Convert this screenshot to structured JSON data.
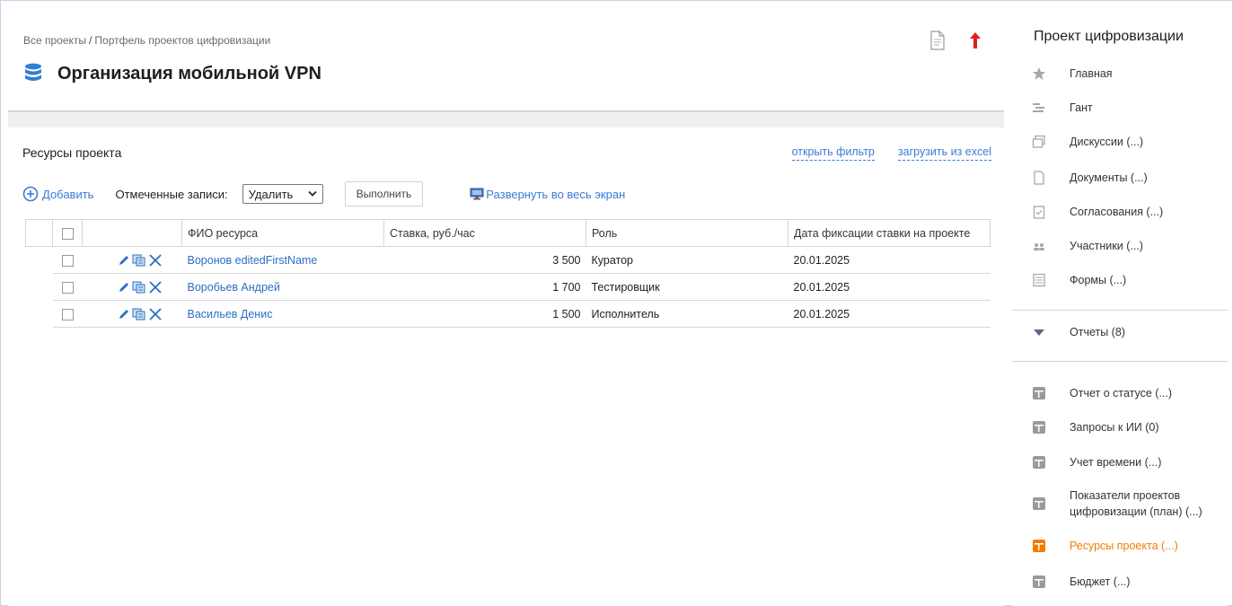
{
  "header": {
    "breadcrumb": {
      "root": "Все проекты",
      "separator": "/",
      "current": "Портфель проектов цифровизации"
    },
    "title": "Организация мобильной VPN"
  },
  "resources": {
    "title": "Ресурсы проекта",
    "open_filter": "открыть фильтр",
    "load_excel": "загрузить из excel",
    "add_label": "Добавить",
    "marked_label": "Отмеченные записи:",
    "action_select": "Удалить",
    "execute_label": "Выполнить",
    "expand_label": "Развернуть во весь экран",
    "columns": [
      "ФИО ресурса",
      "Ставка, руб./час",
      "Роль",
      "Дата фиксации ставки на проекте"
    ],
    "rows": [
      {
        "name": "Воронов editedFirstName",
        "rate": "3 500",
        "role": "Куратор",
        "date": "20.01.2025"
      },
      {
        "name": "Воробьев Андрей",
        "rate": "1 700",
        "role": "Тестировщик",
        "date": "20.01.2025"
      },
      {
        "name": "Васильев Денис",
        "rate": "1 500",
        "role": "Исполнитель",
        "date": "20.01.2025"
      }
    ]
  },
  "sidebar": {
    "title": "Проект цифровизации",
    "items": [
      {
        "label": "Главная",
        "icon": "star-icon"
      },
      {
        "label": "Гант",
        "icon": "gantt-icon"
      },
      {
        "label": "Дискуссии (...)",
        "icon": "discussion-icon"
      },
      {
        "label": "Документы (...)",
        "icon": "document-icon"
      },
      {
        "label": "Согласования (...)",
        "icon": "approval-icon"
      },
      {
        "label": "Участники (...)",
        "icon": "participants-icon"
      },
      {
        "label": "Формы (...)",
        "icon": "forms-icon"
      }
    ],
    "reports_label": "Отчеты (8)",
    "reports": [
      {
        "label": "Отчет о статусе (...)"
      },
      {
        "label": "Запросы к ИИ (0)"
      },
      {
        "label": "Учет времени (...)"
      },
      {
        "label_line1": "Показатели проектов",
        "label_line2": "цифровизации (план) (...)"
      },
      {
        "label": "Ресурсы проекта (...)",
        "active": true
      },
      {
        "label": "Бюджет (...)"
      }
    ]
  },
  "colors": {
    "accent": "#3a7bd5",
    "active": "#f07d00",
    "arrow": "#e0201b",
    "db_icon": "#2f7fd3"
  }
}
